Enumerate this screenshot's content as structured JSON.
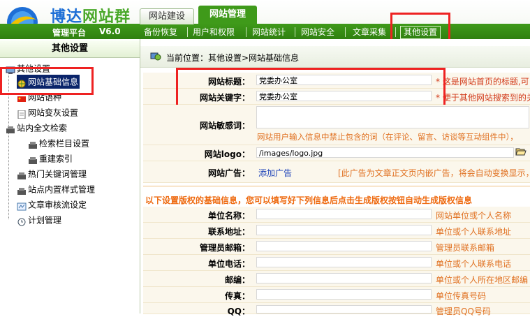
{
  "brand": {
    "title_main": "博达",
    "title_accent": "网站群",
    "subtitle": "管理平台",
    "version": "V6.0"
  },
  "top_tabs": [
    "网站建设",
    "网站管理"
  ],
  "sub_nav": [
    "备份恢复",
    "用户和权限",
    "网站统计",
    "网站安全",
    "文章采集",
    "其他设置"
  ],
  "sidebar": {
    "title": "其他设置",
    "items": [
      {
        "label": "其他设置",
        "icon": "root-computer-icon"
      },
      {
        "label": "网站基础信息",
        "icon": "globe-icon"
      },
      {
        "label": "网站语种",
        "icon": "flag-icon"
      },
      {
        "label": "网站变灰设置",
        "icon": "document-icon"
      },
      {
        "label": "站内全文检索",
        "icon": "search-node-icon"
      },
      {
        "label": "检索栏目设置",
        "icon": "column-icon"
      },
      {
        "label": "重建索引",
        "icon": "rebuild-icon"
      },
      {
        "label": "热门关键词管理",
        "icon": "keyword-icon"
      },
      {
        "label": "站点内置样式管理",
        "icon": "style-icon"
      },
      {
        "label": "文章审核流设定",
        "icon": "workflow-icon"
      },
      {
        "label": "计划管理",
        "icon": "schedule-icon"
      }
    ]
  },
  "breadcrumb": "当前位置：其他设置>网站基础信息",
  "form": {
    "site_title": {
      "label": "网站标题：",
      "value": "党委办公室",
      "hint": "* 这是网站首页的标题,可"
    },
    "site_keywords": {
      "label": "网站关键字：",
      "value": "党委办公室",
      "hint": "* 便于其他网站搜索到的关"
    },
    "sensitive": {
      "label": "网站敏感词：",
      "hint": "网站用户输入信息中禁止包含的词（在评论、留言、访谈等互动组件中），"
    },
    "logo": {
      "label": "网站logo：",
      "value": "/images/logo.jpg"
    },
    "ad": {
      "label": "网站广告：",
      "link": "添加广告",
      "hint": "[此广告为文章正文页内嵌广告，将会自动变换显示，"
    }
  },
  "copyright_heading": "以下设置版权的基础信息，您可以填写好下列信息后点击生成版权按钮自动生成版权信息",
  "copyright_rows": [
    {
      "label": "单位名称：",
      "hint": "网站单位或个人名称"
    },
    {
      "label": "联系地址：",
      "hint": "单位或个人联系地址"
    },
    {
      "label": "管理员邮箱：",
      "hint": "管理员联系邮箱"
    },
    {
      "label": "单位电话：",
      "hint": "单位或个人联系电话"
    },
    {
      "label": "邮编：",
      "hint": "单位或个人所在地区邮编"
    },
    {
      "label": "传真：",
      "hint": "单位传真号码"
    },
    {
      "label": "QQ：",
      "hint": "管理员QQ号码"
    }
  ],
  "colors": {
    "green": "#3f9a1a",
    "highlight": "#ee2222",
    "hint_orange": "#e07020"
  }
}
